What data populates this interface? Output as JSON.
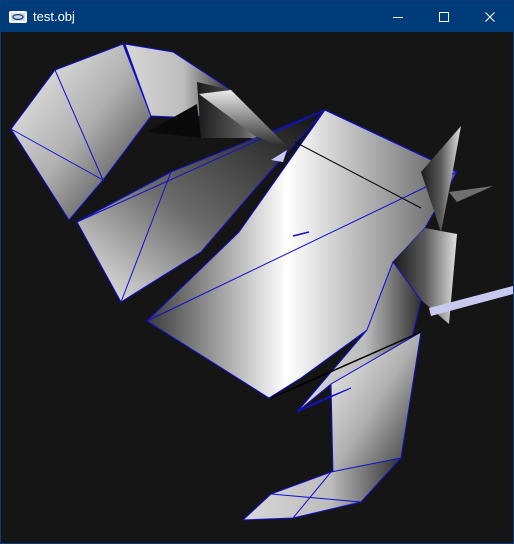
{
  "window": {
    "title": "test.obj",
    "icons": {
      "app": "window-app-icon",
      "minimize": "minimize-icon",
      "maximize": "maximize-icon",
      "close": "close-icon"
    },
    "colors": {
      "titlebar": "#003b7a",
      "viewport_bg": "#151515",
      "wireframe": "#1010d0"
    }
  },
  "scene": {
    "description_name": "3d-model-render",
    "wireframe_color": "#1010d0"
  }
}
